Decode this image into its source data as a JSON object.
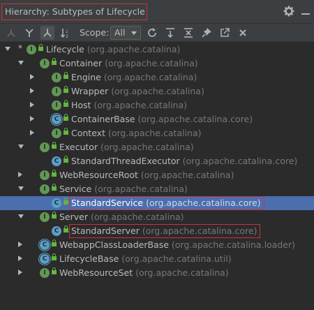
{
  "header": {
    "title": "Hierarchy:  Subtypes of Lifecycle"
  },
  "toolbar": {
    "scope_label": "Scope:",
    "scope_value": "All",
    "buttons": [
      "class-hierarchy-icon",
      "supertypes-icon",
      "subtypes-icon",
      "sort-alphabetically-icon",
      "refresh-icon",
      "export-icon",
      "collapse-all-icon",
      "pin-icon",
      "open-in-window-icon",
      "close-icon"
    ]
  },
  "tree": [
    {
      "name": "Lifecycle",
      "pkg": "(org.apache.catalina)",
      "kind": "interface",
      "level": 0,
      "toggle": "expanded",
      "star": "*"
    },
    {
      "name": "Container",
      "pkg": "(org.apache.catalina)",
      "kind": "interface",
      "level": 1,
      "toggle": "expanded"
    },
    {
      "name": "Engine",
      "pkg": "(org.apache.catalina)",
      "kind": "interface",
      "level": 2,
      "toggle": "collapsed"
    },
    {
      "name": "Wrapper",
      "pkg": "(org.apache.catalina)",
      "kind": "interface",
      "level": 2,
      "toggle": "collapsed"
    },
    {
      "name": "Host",
      "pkg": "(org.apache.catalina)",
      "kind": "interface",
      "level": 2,
      "toggle": "collapsed"
    },
    {
      "name": "ContainerBase",
      "pkg": "(org.apache.catalina.core)",
      "kind": "abstract-class",
      "level": 2,
      "toggle": "collapsed"
    },
    {
      "name": "Context",
      "pkg": "(org.apache.catalina)",
      "kind": "interface",
      "level": 2,
      "toggle": "collapsed"
    },
    {
      "name": "Executor",
      "pkg": "(org.apache.catalina)",
      "kind": "interface",
      "level": 1,
      "toggle": "expanded"
    },
    {
      "name": "StandardThreadExecutor",
      "pkg": "(org.apache.catalina.core)",
      "kind": "class",
      "level": 2,
      "toggle": "none"
    },
    {
      "name": "WebResourceRoot",
      "pkg": "(org.apache.catalina)",
      "kind": "interface",
      "level": 1,
      "toggle": "collapsed"
    },
    {
      "name": "Service",
      "pkg": "(org.apache.catalina)",
      "kind": "interface",
      "level": 1,
      "toggle": "expanded"
    },
    {
      "name": "StandardService",
      "pkg": "(org.apache.catalina.core)",
      "kind": "class",
      "level": 2,
      "toggle": "none",
      "selected": true,
      "highlight": true
    },
    {
      "name": "Server",
      "pkg": "(org.apache.catalina)",
      "kind": "interface",
      "level": 1,
      "toggle": "expanded"
    },
    {
      "name": "StandardServer",
      "pkg": "(org.apache.catalina.core)",
      "kind": "class",
      "level": 2,
      "toggle": "none",
      "highlight": true
    },
    {
      "name": "WebappClassLoaderBase",
      "pkg": "(org.apache.catalina.loader)",
      "kind": "abstract-class",
      "level": 1,
      "toggle": "collapsed"
    },
    {
      "name": "LifecycleBase",
      "pkg": "(org.apache.catalina.util)",
      "kind": "abstract-class",
      "level": 1,
      "toggle": "collapsed"
    },
    {
      "name": "WebResourceSet",
      "pkg": "(org.apache.catalina)",
      "kind": "interface",
      "level": 1,
      "toggle": "collapsed"
    }
  ]
}
